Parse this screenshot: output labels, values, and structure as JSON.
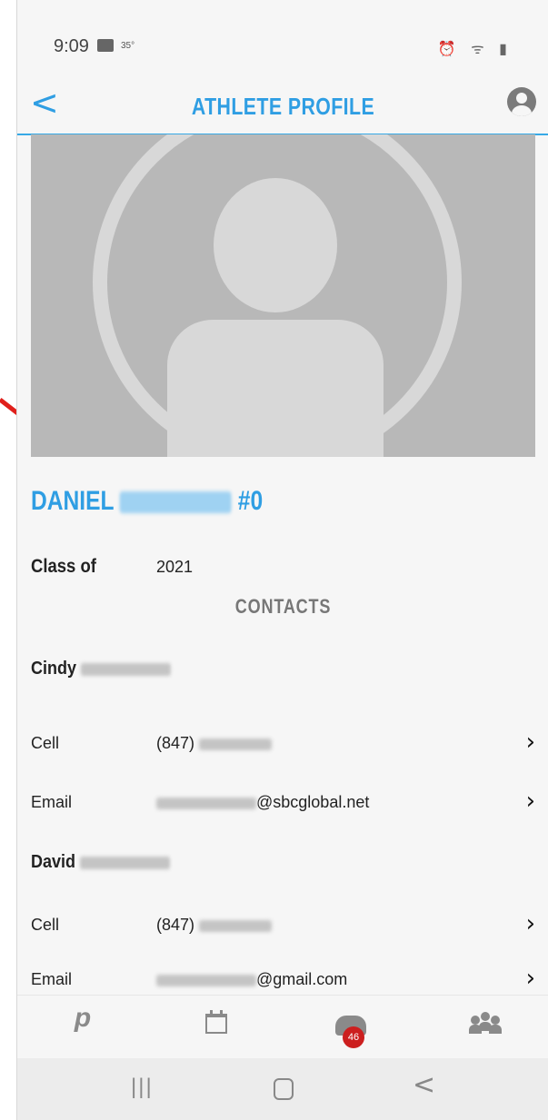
{
  "status_bar": {
    "time": "9:09",
    "temp": "35°",
    "right_icons": [
      "alarm-icon",
      "wifi-icon",
      "signal-icon",
      "battery-icon"
    ]
  },
  "app_bar": {
    "back_label": "<",
    "title": "ATHLETE PROFILE",
    "account_icon": "account-icon"
  },
  "athlete": {
    "first_name": "DANIEL",
    "number": "#0",
    "class_label": "Class of",
    "class_value": "2021"
  },
  "contacts": {
    "heading": "CONTACTS",
    "people": [
      {
        "name": "Cindy",
        "rows": [
          {
            "label": "Cell",
            "value_prefix": "(847)",
            "value_suffix": ""
          },
          {
            "label": "Email",
            "value_prefix": "",
            "value_suffix": "@sbcglobal.net"
          }
        ]
      },
      {
        "name": "David",
        "rows": [
          {
            "label": "Cell",
            "value_prefix": "(847)",
            "value_suffix": ""
          },
          {
            "label": "Email",
            "value_prefix": "",
            "value_suffix": "@gmail.com"
          }
        ]
      }
    ]
  },
  "tab_bar": {
    "tabs": [
      "home-logo-icon",
      "calendar-icon",
      "inbox-icon",
      "team-icon"
    ],
    "inbox_badge": "46",
    "badge_color": "#cc1f1f"
  },
  "nav_bar": {
    "back_glyph": "<"
  },
  "colors": {
    "accent": "#2f9ee3",
    "annotation_arrow": "#e0201b"
  }
}
